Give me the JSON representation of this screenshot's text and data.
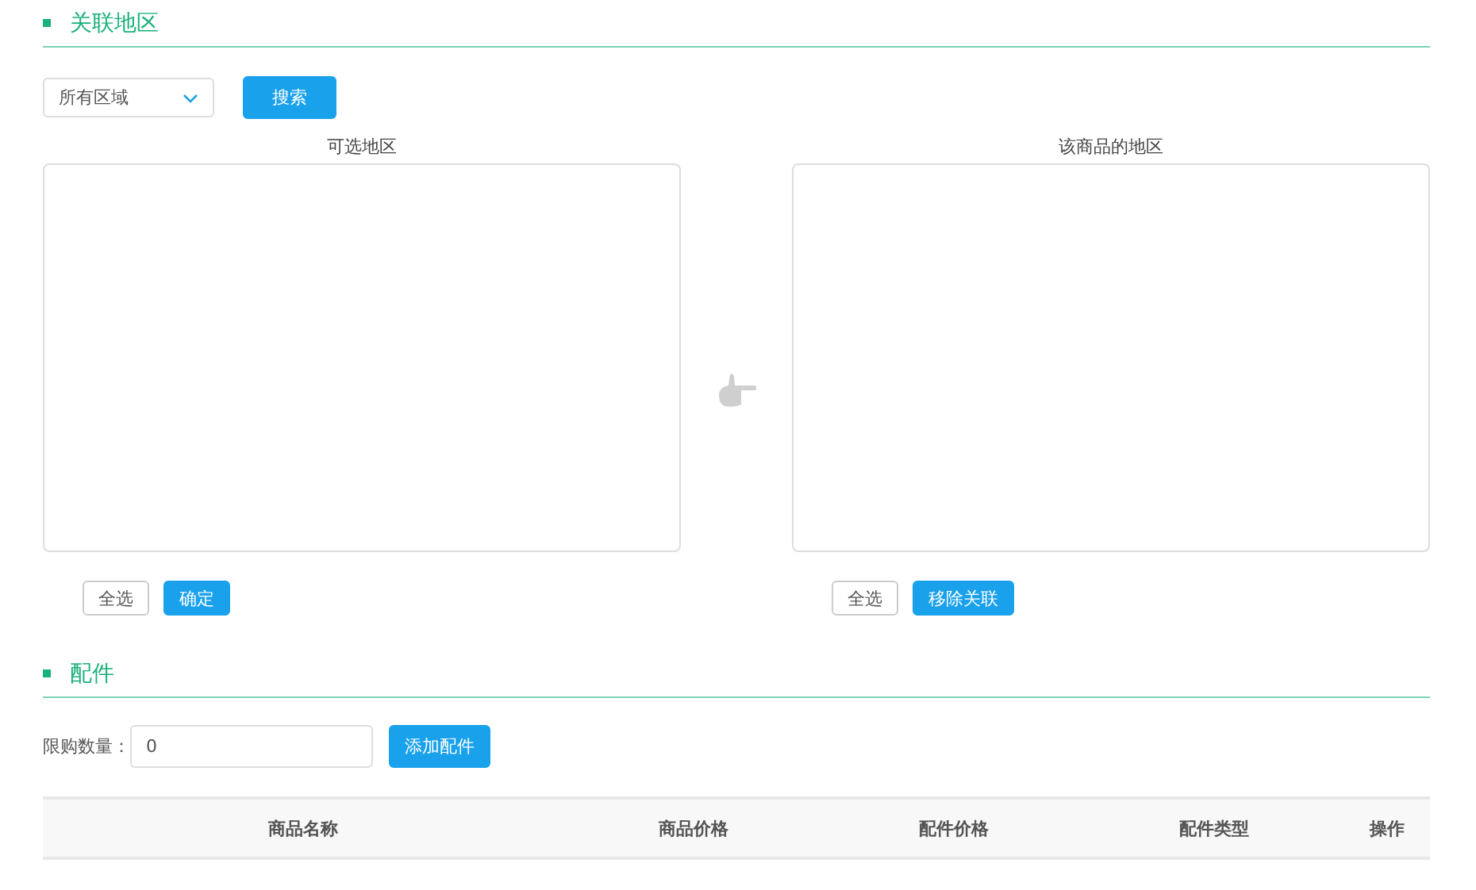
{
  "region_section": {
    "title": "关联地区",
    "region_select": {
      "value": "所有区域"
    },
    "search_button": "搜索",
    "available_panel": {
      "title": "可选地区",
      "buttons": [
        "全选",
        "确定"
      ]
    },
    "linked_panel": {
      "title": "该商品的地区",
      "buttons": [
        "全选",
        "移除关联"
      ]
    }
  },
  "parts_section": {
    "title": "配件",
    "limit_label": "限购数量：",
    "limit_value": "0",
    "add_button": "添加配件",
    "table": {
      "columns": [
        "商品名称",
        "商品价格",
        "配件价格",
        "配件类型",
        "操作"
      ]
    }
  }
}
